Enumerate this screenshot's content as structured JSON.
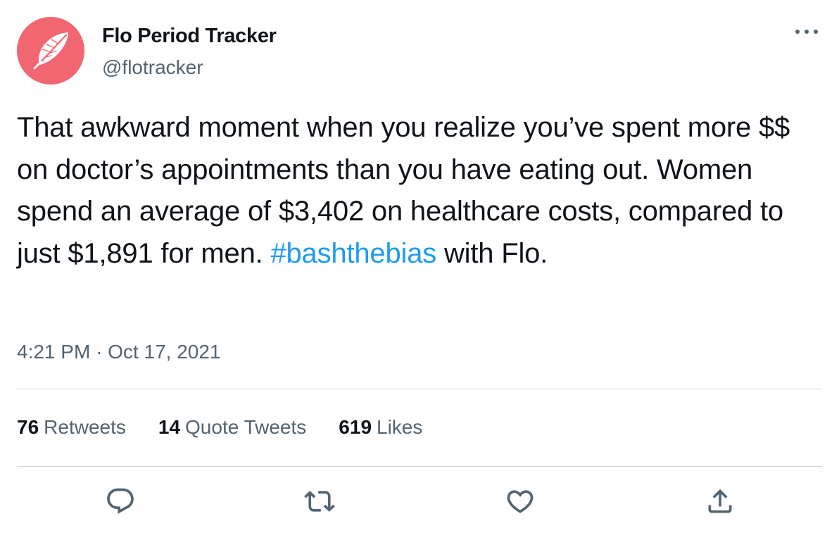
{
  "tweet": {
    "author": {
      "name": "Flo Period Tracker",
      "handle": "@flotracker",
      "avatar_icon": "feather-icon",
      "avatar_color": "#f26672"
    },
    "more_icon": "more-icon",
    "text_part1": "That awkward moment when you realize you’ve spent more $$ on doctor’s appointments than you have eating out. Women spend an average of $3,402 on healthcare costs, compared to just $1,891 for men.",
    "hashtag": "#bashthebias",
    "text_part2": "with Flo.",
    "time": "4:21 PM",
    "separator": "·",
    "date": "Oct 17, 2021",
    "stats": {
      "retweets_count": "76",
      "retweets_label": "Retweets",
      "quotes_count": "14",
      "quotes_label": "Quote Tweets",
      "likes_count": "619",
      "likes_label": "Likes"
    },
    "actions": [
      "reply-icon",
      "retweet-icon",
      "like-icon",
      "share-icon"
    ],
    "colors": {
      "accent": "#1d9bf0",
      "secondary_text": "#536471",
      "primary_text": "#0f1419",
      "divider": "#cfd9de"
    }
  }
}
